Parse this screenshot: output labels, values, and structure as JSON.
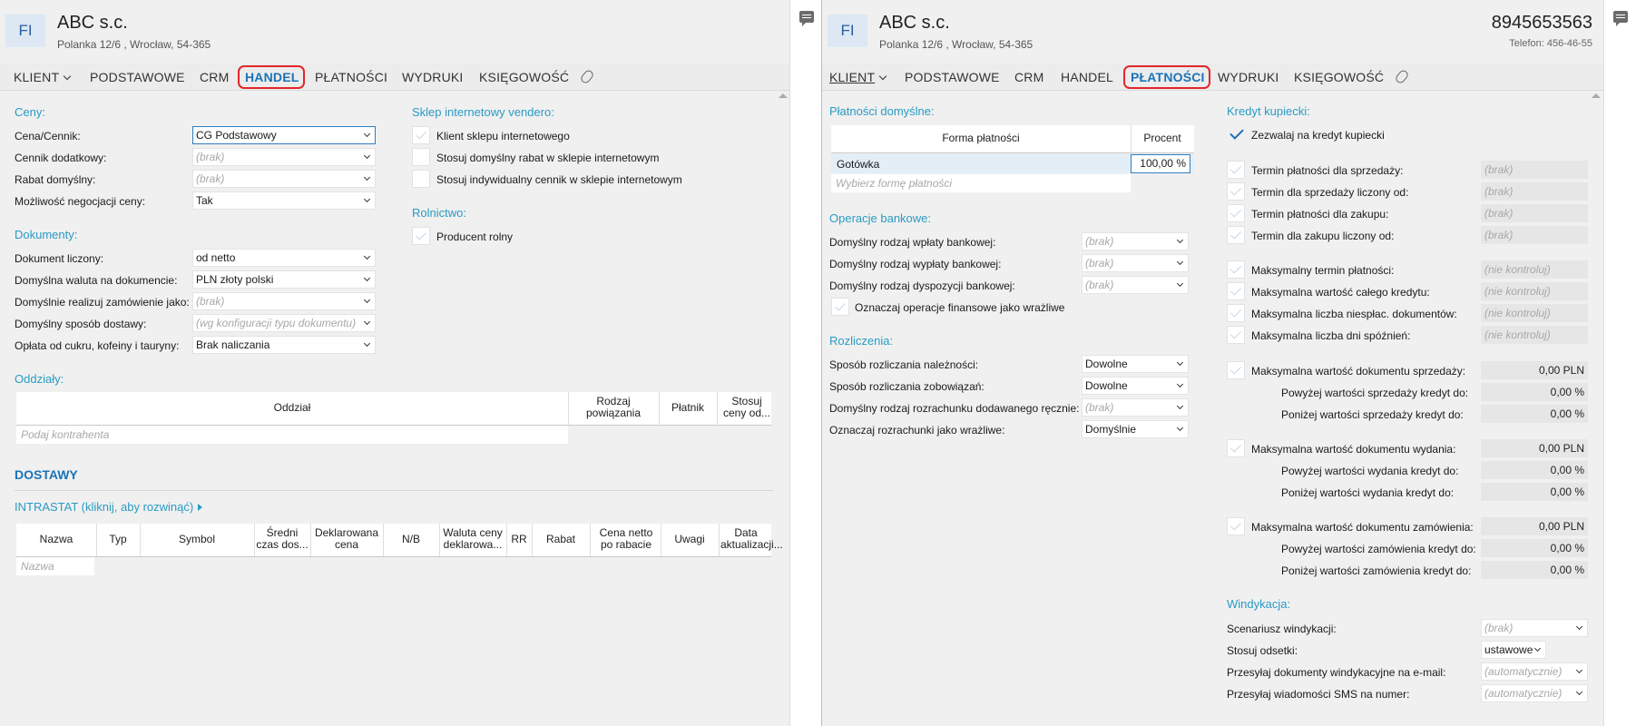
{
  "left": {
    "badge": "FI",
    "company_name": "ABC s.c.",
    "company_address": "Polanka  12/6 , Wrocław, 54-365",
    "tabs": {
      "klient": "KLIENT",
      "podstawowe": "PODSTAWOWE",
      "crm": "CRM",
      "handel": "HANDEL",
      "platnosci": "PŁATNOŚCI",
      "wydruki": "WYDRUKI",
      "ksiegowosc": "KSIĘGOWOŚĆ"
    },
    "ceny": {
      "title": "Ceny:",
      "cena_cennik_label": "Cena/Cennik:",
      "cena_cennik_value": "CG  Podstawowy",
      "cennik_dodatkowy_label": "Cennik dodatkowy:",
      "cennik_dodatkowy_value": "(brak)",
      "rabat_label": "Rabat domyślny:",
      "rabat_value": "(brak)",
      "negocjacja_label": "Możliwość negocjacji ceny:",
      "negocjacja_value": "Tak"
    },
    "sklep": {
      "title": "Sklep internetowy vendero:",
      "klient_sklepu": "Klient sklepu internetowego",
      "rabat_sklep": "Stosuj domyślny rabat w sklepie internetowym",
      "cennik_sklep": "Stosuj indywidualny cennik w sklepie internetowym"
    },
    "rolnictwo": {
      "title": "Rolnictwo:",
      "producent": "Producent rolny"
    },
    "dokumenty": {
      "title": "Dokumenty:",
      "dok_liczony_label": "Dokument liczony:",
      "dok_liczony_value": "od netto",
      "waluta_label": "Domyślna waluta na dokumencie:",
      "waluta_value": "PLN  złoty polski",
      "realizuj_label": "Domyślnie realizuj zamówienie jako:",
      "realizuj_value": "(brak)",
      "dostawa_label": "Domyślny sposób dostawy:",
      "dostawa_value": "(wg konfiguracji typu dokumentu)",
      "oplata_label": "Opłata od cukru, kofeiny i tauryny:",
      "oplata_value": "Brak naliczania"
    },
    "oddzialy": {
      "title": "Oddziały:",
      "col_oddzial": "Oddział",
      "col_rodzaj": "Rodzaj powiązania",
      "col_platnik": "Płatnik",
      "col_stosuj": "Stosuj ceny od...",
      "placeholder": "Podaj kontrahenta"
    },
    "dostawy": {
      "title": "DOSTAWY",
      "intrastat": "INTRASTAT (kliknij, aby rozwinąć)",
      "cols": {
        "nazwa": "Nazwa",
        "typ": "Typ",
        "symbol": "Symbol",
        "sredni": "Średni czas dos...",
        "deklarowana": "Deklarowana cena",
        "nb": "N/B",
        "waluta": "Waluta ceny deklarowa...",
        "rr": "RR",
        "rabat": "Rabat",
        "cena_netto": "Cena netto po rabacie",
        "uwagi": "Uwagi",
        "data": "Data aktualizacji..."
      },
      "placeholder": "Nazwa"
    }
  },
  "right": {
    "badge": "FI",
    "company_name": "ABC s.c.",
    "company_address": "Polanka  12/6 , Wrocław, 54-365",
    "nip": "8945653563",
    "phone": "Telefon: 456-46-55",
    "tabs": {
      "klient": "KLIENT",
      "podstawowe": "PODSTAWOWE",
      "crm": "CRM",
      "handel": "HANDEL",
      "platnosci": "PŁATNOŚCI",
      "wydruki": "WYDRUKI",
      "ksiegowosc": "KSIĘGOWOŚĆ"
    },
    "platnosci_domyslne": {
      "title": "Płatności domyślne:",
      "col_forma": "Forma płatności",
      "col_procent": "Procent",
      "row_forma": "Gotówka",
      "row_procent": "100,00 %",
      "placeholder": "Wybierz formę płatności"
    },
    "operacje": {
      "title": "Operacje bankowe:",
      "wplata_label": "Domyślny rodzaj wpłaty bankowej:",
      "wplata_value": "(brak)",
      "wyplata_label": "Domyślny rodzaj wypłaty bankowej:",
      "wyplata_value": "(brak)",
      "dyspozycja_label": "Domyślny rodzaj dyspozycji bankowej:",
      "dyspozycja_value": "(brak)",
      "wrazliwe": "Oznaczaj operacje finansowe jako wrażliwe"
    },
    "rozliczenia": {
      "title": "Rozliczenia:",
      "naleznosci_label": "Sposób rozliczania należności:",
      "naleznosci_value": "Dowolne",
      "zobowiazan_label": "Sposób rozliczania zobowiązań:",
      "zobowiazan_value": "Dowolne",
      "rozrachunek_label": "Domyślny rodzaj rozrachunku dodawanego ręcznie:",
      "rozrachunek_value": "(brak)",
      "wrazliwe_label": "Oznaczaj rozrachunki jako wrażliwe:",
      "wrazliwe_value": "Domyślnie"
    },
    "kredyt": {
      "title": "Kredyt kupiecki:",
      "zezwalaj": "Zezwalaj na kredyt kupiecki",
      "termin_sprzedazy": "Termin płatności dla sprzedaży:",
      "termin_sprzedazy_liczony": "Termin dla sprzedaży liczony od:",
      "termin_zakupu": "Termin płatności dla zakupu:",
      "termin_zakupu_liczony": "Termin dla zakupu liczony od:",
      "brak": "(brak)",
      "max_termin": "Maksymalny termin płatności:",
      "max_wartosc_kredytu": "Maksymalna wartość całego kredytu:",
      "max_liczba_dok": "Maksymalna liczba niespłac. dokumentów:",
      "max_dni": "Maksymalna liczba dni spóźnień:",
      "nie_kontroluj": "(nie kontroluj)",
      "max_dok_sprzedazy": "Maksymalna wartość dokumentu sprzedaży:",
      "powyzej_sprzedazy": "Powyżej wartości sprzedaży kredyt do:",
      "ponizej_sprzedazy": "Poniżej wartości sprzedaży kredyt do:",
      "max_dok_wydania": "Maksymalna wartość dokumentu wydania:",
      "powyzej_wydania": "Powyżej wartości wydania kredyt do:",
      "ponizej_wydania": "Poniżej wartości wydania kredyt do:",
      "max_dok_zamowienia": "Maksymalna wartość dokumentu zamówienia:",
      "powyzej_zamowienia": "Powyżej wartości zamówienia kredyt do:",
      "ponizej_zamowienia": "Poniżej wartości zamówienia kredyt do:",
      "pln": "0,00 PLN",
      "pct": "0,00 %"
    },
    "windykacja": {
      "title": "Windykacja:",
      "scenariusz_label": "Scenariusz windykacji:",
      "scenariusz_value": "(brak)",
      "odsetki_label": "Stosuj odsetki:",
      "odsetki_value": "ustawowe",
      "email_label": "Przesyłaj dokumenty windykacyjne na e-mail:",
      "email_value": "(automatycznie)",
      "sms_label": "Przesyłaj wiadomości SMS na numer:",
      "sms_value": "(automatycznie)"
    }
  }
}
